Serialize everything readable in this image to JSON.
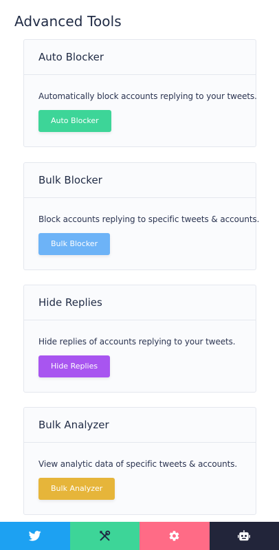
{
  "page": {
    "title": "Advanced Tools"
  },
  "cards": [
    {
      "title": "Auto Blocker",
      "description": "Automatically block accounts replying to your tweets.",
      "button_label": "Auto Blocker",
      "button_color": "#3dd598"
    },
    {
      "title": "Bulk Blocker",
      "description": "Block accounts replying to specific tweets & accounts.",
      "button_label": "Bulk Blocker",
      "button_color": "#6db3f7"
    },
    {
      "title": "Hide Replies",
      "description": "Hide replies of accounts replying to your tweets.",
      "button_label": "Hide Replies",
      "button_color": "#a855f0"
    },
    {
      "title": "Bulk Analyzer",
      "description": "View analytic data of specific tweets & accounts.",
      "button_label": "Bulk Analyzer",
      "button_color": "#e6b53a"
    }
  ],
  "tabbar": [
    {
      "icon": "twitter-bird-icon",
      "color": "#1da1f2"
    },
    {
      "icon": "tools-icon",
      "color": "#3dd598"
    },
    {
      "icon": "gear-icon",
      "color": "#ff6b86"
    },
    {
      "icon": "robot-icon",
      "color": "#22253a"
    }
  ]
}
